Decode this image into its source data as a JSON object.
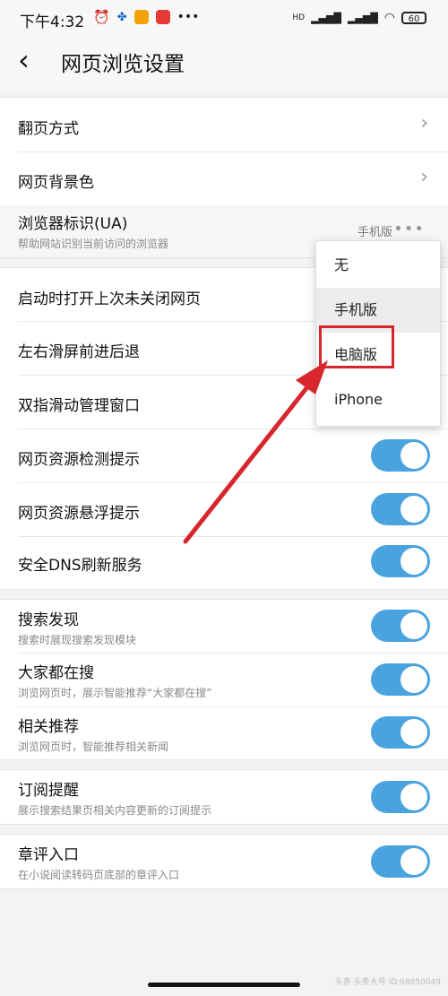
{
  "status_bar": {
    "time": "下午4:32",
    "battery": "60",
    "network_label": "HD"
  },
  "header": {
    "title": "网页浏览设置"
  },
  "group1": {
    "rows": [
      {
        "title": "翻页方式"
      },
      {
        "title": "网页背景色"
      }
    ],
    "ua": {
      "title": "浏览器标识(UA)",
      "subtitle": "帮助网站识别当前访问的浏览器",
      "value": "手机版",
      "more": "•••"
    }
  },
  "dropdown": {
    "options": [
      "无",
      "手机版",
      "电脑版",
      "iPhone"
    ],
    "selected": "手机版",
    "highlighted": "电脑版"
  },
  "group2": {
    "rows": [
      {
        "title": "启动时打开上次未关闭网页",
        "toggle": true
      },
      {
        "title": "左右滑屏前进后退",
        "toggle": true
      },
      {
        "title": "双指滑动管理窗口",
        "toggle": true
      },
      {
        "title": "网页资源检测提示",
        "toggle": true
      },
      {
        "title": "网页资源悬浮提示",
        "toggle": true
      },
      {
        "title": "安全DNS刷新服务",
        "toggle": true
      }
    ]
  },
  "group3": {
    "rows": [
      {
        "title": "搜索发现",
        "subtitle": "搜索时展现搜索发现模块",
        "toggle": true
      },
      {
        "title": "大家都在搜",
        "subtitle": "浏览网页时，展示智能推荐“大家都在搜”",
        "toggle": true
      },
      {
        "title": "相关推荐",
        "subtitle": "浏览网页时，智能推荐相关新闻",
        "toggle": true
      }
    ]
  },
  "group4": {
    "title": "订阅提醒",
    "subtitle": "展示搜索结果页相关内容更新的订阅提示",
    "toggle": true
  },
  "group5": {
    "title": "章评入口",
    "subtitle": "在小说阅读转码页底部的章评入口",
    "toggle": true
  },
  "watermark": "头条 头条大号 ID:68850049",
  "colors": {
    "toggle_on": "#4aa3df",
    "annotation_red": "#d7262d"
  }
}
